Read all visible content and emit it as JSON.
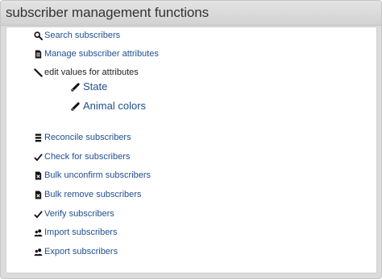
{
  "header": {
    "title": "subscriber management functions"
  },
  "menu": {
    "search": {
      "label": "Search subscribers",
      "icon": "search-icon"
    },
    "manage_attributes": {
      "label": "Manage subscriber attributes",
      "icon": "document-icon"
    },
    "edit_values": {
      "label": "edit values for attributes",
      "icon": "pencil-icon"
    },
    "edit_state": {
      "label": "State",
      "icon": "pencil-icon"
    },
    "edit_animal_colors": {
      "label": "Animal colors",
      "icon": "pencil-icon"
    },
    "reconcile": {
      "label": "Reconcile subscribers",
      "icon": "list-icon"
    },
    "check": {
      "label": "Check for subscribers",
      "icon": "checkmark-icon"
    },
    "bulk_unconfirm": {
      "label": "Bulk unconfirm subscribers",
      "icon": "document-cross-icon"
    },
    "bulk_remove": {
      "label": "Bulk remove subscribers",
      "icon": "document-cross-icon"
    },
    "verify": {
      "label": "Verify subscribers",
      "icon": "checkmark-icon"
    },
    "import": {
      "label": "Import subscribers",
      "icon": "users-icon"
    },
    "export": {
      "label": "Export subscribers",
      "icon": "users-icon"
    }
  },
  "colors": {
    "link": "#1f4f8f",
    "header_bg": "#dcdcdc",
    "panel_bg": "#ffffff"
  }
}
